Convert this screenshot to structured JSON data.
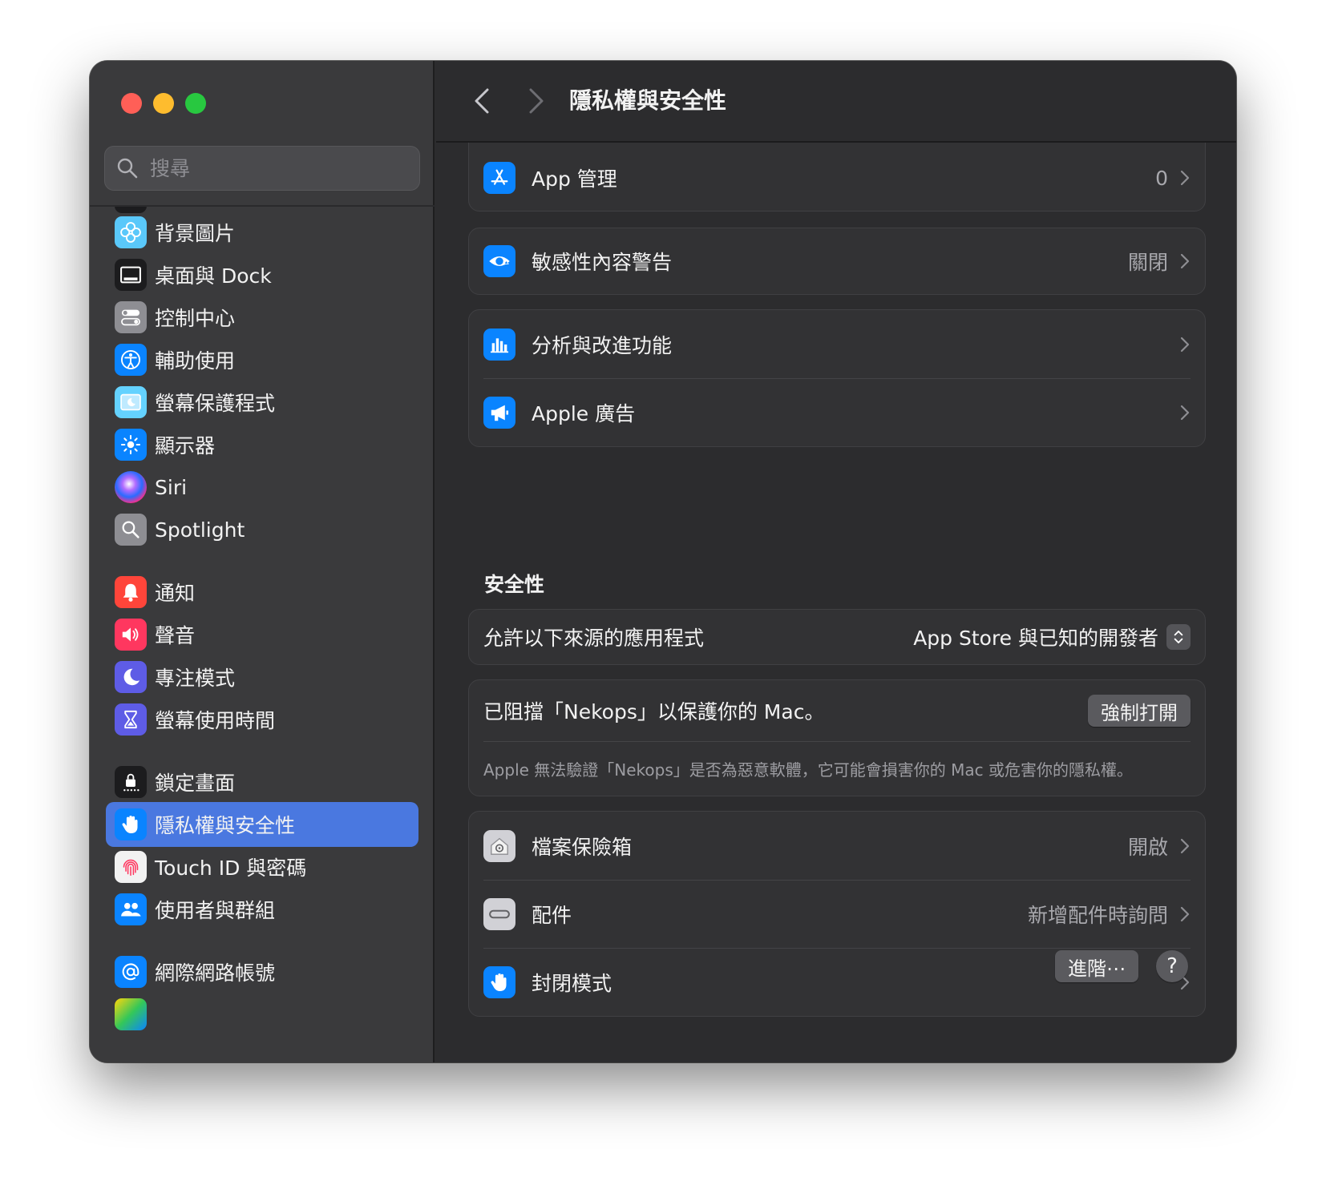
{
  "window": {
    "title": "隱私權與安全性"
  },
  "search": {
    "placeholder": "搜尋"
  },
  "sidebar": {
    "items": [
      {
        "label": "背景圖片",
        "icon": "wallpaper-icon",
        "color": "#5ac8fa"
      },
      {
        "label": "桌面與 Dock",
        "icon": "dock-icon",
        "color": "#1c1c1e"
      },
      {
        "label": "控制中心",
        "icon": "control-center-icon",
        "color": "#8e8e93"
      },
      {
        "label": "輔助使用",
        "icon": "accessibility-icon",
        "color": "#0a84ff"
      },
      {
        "label": "螢幕保護程式",
        "icon": "screensaver-icon",
        "color": "#64d2ff"
      },
      {
        "label": "顯示器",
        "icon": "display-icon",
        "color": "#0a84ff"
      },
      {
        "label": "Siri",
        "icon": "siri-icon",
        "color": "#3a3a3c"
      },
      {
        "label": "Spotlight",
        "icon": "spotlight-icon",
        "color": "#8e8e93"
      },
      {
        "label": "通知",
        "icon": "notifications-icon",
        "color": "#ff453a"
      },
      {
        "label": "聲音",
        "icon": "sound-icon",
        "color": "#ff375f"
      },
      {
        "label": "專注模式",
        "icon": "focus-icon",
        "color": "#5e5ce6"
      },
      {
        "label": "螢幕使用時間",
        "icon": "screen-time-icon",
        "color": "#5e5ce6"
      },
      {
        "label": "鎖定畫面",
        "icon": "lock-screen-icon",
        "color": "#1c1c1e"
      },
      {
        "label": "隱私權與安全性",
        "icon": "hand-icon",
        "color": "#0a84ff",
        "active": true
      },
      {
        "label": "Touch ID 與密碼",
        "icon": "fingerprint-icon",
        "color": "#f2f2f2"
      },
      {
        "label": "使用者與群組",
        "icon": "users-icon",
        "color": "#0a84ff"
      },
      {
        "label": "網際網路帳號",
        "icon": "at-icon",
        "color": "#0a84ff"
      }
    ]
  },
  "privacy": {
    "app_management": {
      "label": "App 管理",
      "value": "0"
    },
    "sensitive_content": {
      "label": "敏感性內容警告",
      "value": "關閉"
    },
    "analytics": {
      "label": "分析與改進功能"
    },
    "apple_ads": {
      "label": "Apple 廣告"
    }
  },
  "security": {
    "section_title": "安全性",
    "allow_apps_label": "允許以下來源的應用程式",
    "allow_apps_value": "App Store 與已知的開發者",
    "blocked_message": "已阻擋「Nekops」以保護你的 Mac。",
    "open_anyway_button": "強制打開",
    "warning_note": "Apple 無法驗證「Nekops」是否為惡意軟體，它可能會損害你的 Mac 或危害你的隱私權。",
    "filevault": {
      "label": "檔案保險箱",
      "value": "開啟"
    },
    "accessories": {
      "label": "配件",
      "value": "新增配件時詢問"
    },
    "lockdown": {
      "label": "封閉模式"
    }
  },
  "footer": {
    "advanced_button": "進階⋯",
    "help_button": "?"
  },
  "colors": {
    "accent": "#4a78e0",
    "window_bg": "#2c2c2e",
    "sidebar_bg": "#3a3a3c"
  }
}
